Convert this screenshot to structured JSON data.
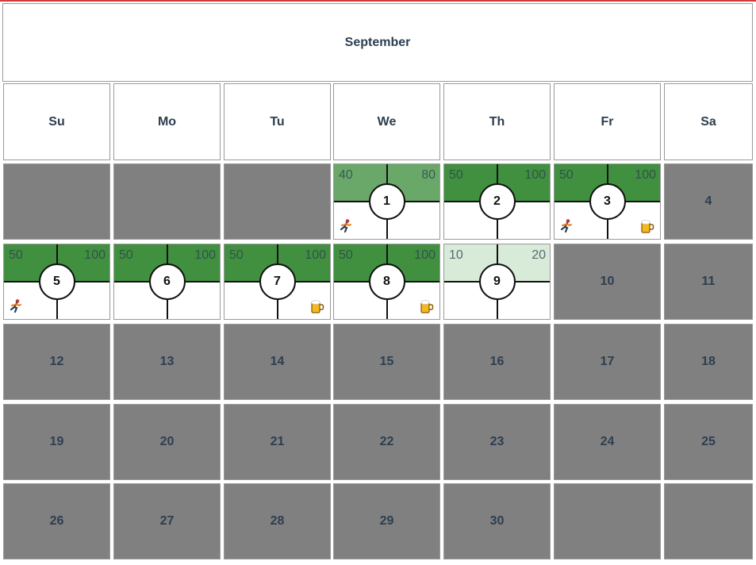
{
  "calendar": {
    "month": "September",
    "weekdays": [
      "Su",
      "Mo",
      "Tu",
      "We",
      "Th",
      "Fr",
      "Sa"
    ],
    "rows": [
      [
        {
          "type": "blank"
        },
        {
          "type": "blank"
        },
        {
          "type": "blank"
        },
        {
          "type": "active",
          "day": "1",
          "left": "40",
          "right": "80",
          "color": "#6aa86a",
          "run": true,
          "beer": false
        },
        {
          "type": "active",
          "day": "2",
          "left": "50",
          "right": "100",
          "color": "#409040",
          "run": false,
          "beer": false
        },
        {
          "type": "active",
          "day": "3",
          "left": "50",
          "right": "100",
          "color": "#409040",
          "run": true,
          "beer": true
        },
        {
          "type": "plain",
          "day": "4"
        }
      ],
      [
        {
          "type": "active",
          "day": "5",
          "left": "50",
          "right": "100",
          "color": "#409040",
          "run": true,
          "beer": false
        },
        {
          "type": "active",
          "day": "6",
          "left": "50",
          "right": "100",
          "color": "#409040",
          "run": false,
          "beer": false
        },
        {
          "type": "active",
          "day": "7",
          "left": "50",
          "right": "100",
          "color": "#409040",
          "run": false,
          "beer": true
        },
        {
          "type": "active",
          "day": "8",
          "left": "50",
          "right": "100",
          "color": "#409040",
          "run": false,
          "beer": true
        },
        {
          "type": "active",
          "day": "9",
          "left": "10",
          "right": "20",
          "color": "#d8ead8",
          "run": false,
          "beer": false
        },
        {
          "type": "plain",
          "day": "10"
        },
        {
          "type": "plain",
          "day": "11"
        }
      ],
      [
        {
          "type": "plain",
          "day": "12"
        },
        {
          "type": "plain",
          "day": "13"
        },
        {
          "type": "plain",
          "day": "14"
        },
        {
          "type": "plain",
          "day": "15"
        },
        {
          "type": "plain",
          "day": "16"
        },
        {
          "type": "plain",
          "day": "17"
        },
        {
          "type": "plain",
          "day": "18"
        }
      ],
      [
        {
          "type": "plain",
          "day": "19"
        },
        {
          "type": "plain",
          "day": "20"
        },
        {
          "type": "plain",
          "day": "21"
        },
        {
          "type": "plain",
          "day": "22"
        },
        {
          "type": "plain",
          "day": "23"
        },
        {
          "type": "plain",
          "day": "24"
        },
        {
          "type": "plain",
          "day": "25"
        }
      ],
      [
        {
          "type": "plain",
          "day": "26"
        },
        {
          "type": "plain",
          "day": "27"
        },
        {
          "type": "plain",
          "day": "28"
        },
        {
          "type": "plain",
          "day": "29"
        },
        {
          "type": "plain",
          "day": "30"
        },
        {
          "type": "blank"
        },
        {
          "type": "blank"
        }
      ]
    ],
    "icons": {
      "activity": "runner-icon",
      "drink": "beer-mug-icon"
    }
  }
}
